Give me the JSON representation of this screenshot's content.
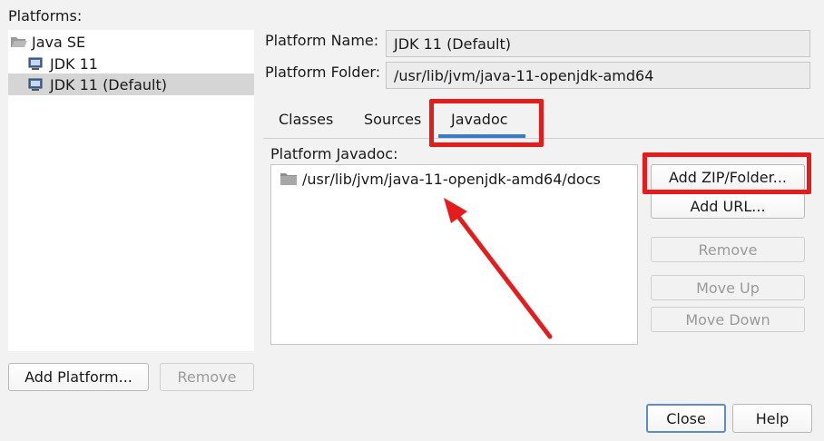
{
  "platforms": {
    "label": "Platforms:",
    "tree": {
      "root": "Java SE",
      "items": [
        {
          "label": "JDK 11",
          "selected": false
        },
        {
          "label": "JDK 11 (Default)",
          "selected": true
        }
      ]
    },
    "add_button": "Add Platform...",
    "remove_button": "Remove"
  },
  "details": {
    "name_label": "Platform Name:",
    "name_value": "JDK 11 (Default)",
    "folder_label": "Platform Folder:",
    "folder_value": "/usr/lib/jvm/java-11-openjdk-amd64"
  },
  "tabs": [
    {
      "label": "Classes",
      "active": false
    },
    {
      "label": "Sources",
      "active": false
    },
    {
      "label": "Javadoc",
      "active": true
    }
  ],
  "javadoc": {
    "label": "Platform Javadoc:",
    "entries": [
      "/usr/lib/jvm/java-11-openjdk-amd64/docs"
    ],
    "buttons": {
      "add_zip": "Add ZIP/Folder...",
      "add_url": "Add URL...",
      "remove": "Remove",
      "move_up": "Move Up",
      "move_down": "Move Down"
    }
  },
  "footer": {
    "close": "Close",
    "help": "Help"
  },
  "colors": {
    "annotation": "#e41c1c",
    "tab_underline": "#3a7bc8",
    "selection": "#d5d5d5"
  },
  "icons": {
    "root": "folder-open-icon",
    "platform": "monitor-icon",
    "entry": "folder-icon"
  }
}
